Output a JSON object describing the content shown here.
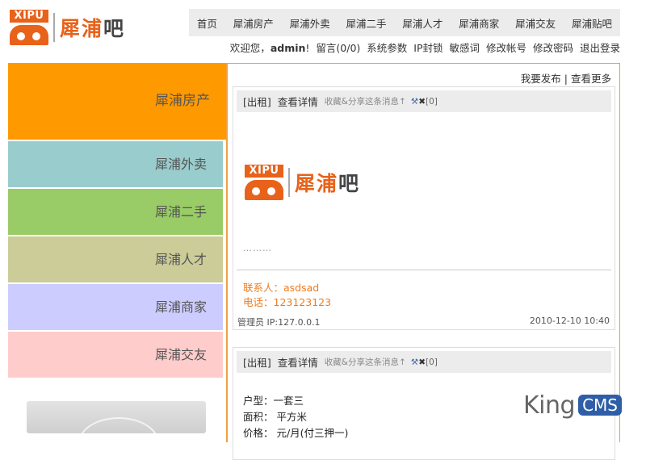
{
  "logo": {
    "badge": "XIPU",
    "name_orange": "犀浦",
    "name_dark": "吧"
  },
  "topnav": [
    "首页",
    "犀浦房产",
    "犀浦外卖",
    "犀浦二手",
    "犀浦人才",
    "犀浦商家",
    "犀浦交友",
    "犀浦贴吧"
  ],
  "userbar": {
    "welcome": "欢迎您，",
    "username": "admin",
    "excl": "!",
    "links": [
      "留言(0/0)",
      "系统参数",
      "IP封锁",
      "敏感词",
      "修改帐号",
      "修改密码",
      "退出登录"
    ]
  },
  "sidebar": {
    "categories": [
      {
        "label": "犀浦房产",
        "color": "#ff9900"
      },
      {
        "label": "犀浦外卖",
        "color": "#99cccc"
      },
      {
        "label": "犀浦二手",
        "color": "#99cc66"
      },
      {
        "label": "犀浦人才",
        "color": "#cccc99"
      },
      {
        "label": "犀浦商家",
        "color": "#ccccff"
      },
      {
        "label": "犀浦交友",
        "color": "#ffcccc"
      }
    ]
  },
  "main": {
    "publish": "我要发布",
    "sep": "|",
    "more": "查看更多",
    "posts": [
      {
        "tag": "[出租]",
        "detail": "查看详情",
        "fav": "收藏&分享这条消息↑",
        "count": "[0]",
        "dots": "………",
        "contact_person": "联系人：asdsad",
        "phone": "电话：123123123",
        "author": "管理员 IP:127.0.0.1",
        "date": "2010-12-10 10:40"
      },
      {
        "tag": "[出租]",
        "detail": "查看详情",
        "fav": "收藏&分享这条消息↑",
        "count": "[0]",
        "lines": [
          "户型：一套三",
          "面积：  平方米",
          "价格：  元/月(付三押一)"
        ]
      }
    ]
  },
  "watermark": {
    "king": "King",
    "cms": "CMS"
  },
  "colors": {
    "accent": "#e8621a",
    "border": "#f0a040",
    "contact": "#f07c1e"
  },
  "icons": [
    "wrench-icon",
    "delete-icon"
  ]
}
